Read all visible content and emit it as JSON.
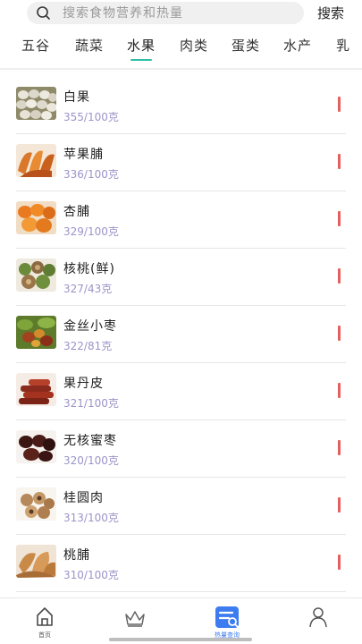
{
  "search": {
    "placeholder": "搜索食物营养和热量",
    "button_label": "搜索"
  },
  "tabs": [
    {
      "label": "五谷",
      "active": false
    },
    {
      "label": "蔬菜",
      "active": false
    },
    {
      "label": "水果",
      "active": true
    },
    {
      "label": "肉类",
      "active": false
    },
    {
      "label": "蛋类",
      "active": false
    },
    {
      "label": "水产",
      "active": false
    },
    {
      "label": "乳",
      "active": false
    }
  ],
  "foods": [
    {
      "name": "白果",
      "calories": "355/100克",
      "icon": "ginkgo-nut-image"
    },
    {
      "name": "苹果脯",
      "calories": "336/100克",
      "icon": "dried-apple-image"
    },
    {
      "name": "杏脯",
      "calories": "329/100克",
      "icon": "dried-apricot-image"
    },
    {
      "name": "核桃(鲜)",
      "calories": "327/43克",
      "icon": "fresh-walnut-image"
    },
    {
      "name": "金丝小枣",
      "calories": "322/81克",
      "icon": "golden-jujube-image"
    },
    {
      "name": "果丹皮",
      "calories": "321/100克",
      "icon": "haw-roll-image"
    },
    {
      "name": "无核蜜枣",
      "calories": "320/100克",
      "icon": "seedless-candied-date-image"
    },
    {
      "name": "桂圆肉",
      "calories": "313/100克",
      "icon": "longan-pulp-image"
    },
    {
      "name": "桃脯",
      "calories": "310/100克",
      "icon": "dried-peach-image"
    }
  ],
  "bottom_nav": [
    {
      "label": "首页",
      "icon": "home-icon",
      "active": false
    },
    {
      "label": "",
      "icon": "crown-icon",
      "active": false
    },
    {
      "label": "热量查询",
      "icon": "calorie-query-icon",
      "active": true
    },
    {
      "label": "",
      "icon": "profile-icon",
      "active": false
    }
  ],
  "colors": {
    "accent": "#2bbfa4",
    "calorie_text": "#9b94c9",
    "marker": "#e4605e",
    "nav_active": "#3d7cf0"
  }
}
